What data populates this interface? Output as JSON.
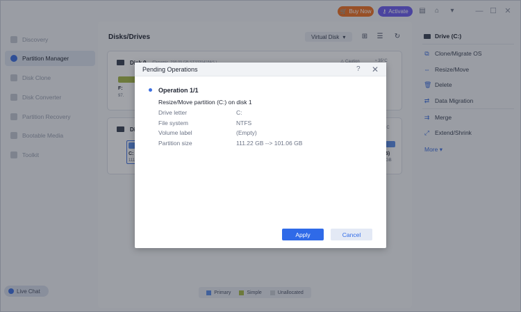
{
  "titlebar": {
    "buy_now": "Buy Now",
    "activate": "Activate",
    "buy_color": "#f07022",
    "activate_color": "#6b5cf0"
  },
  "sidebar": {
    "items": [
      {
        "label": "Discovery",
        "icon": "compass-icon",
        "active": false
      },
      {
        "label": "Partition Manager",
        "icon": "pie-chart-icon",
        "active": true
      },
      {
        "label": "Disk Clone",
        "icon": "clone-icon",
        "active": false
      },
      {
        "label": "Disk Converter",
        "icon": "convert-icon",
        "active": false
      },
      {
        "label": "Partition Recovery",
        "icon": "recovery-icon",
        "active": false
      },
      {
        "label": "Bootable Media",
        "icon": "media-icon",
        "active": false
      },
      {
        "label": "Toolkit",
        "icon": "toolkit-icon",
        "active": false
      }
    ],
    "live_chat": "Live Chat"
  },
  "main": {
    "title": "Disks/Drives",
    "view_select": "Virtual Disk",
    "disk0": {
      "name": "Disk 0",
      "sub": "(Dynamic, 298.09 GB,ST3320418AS )",
      "caution": "Caution",
      "temp": "35°C",
      "part_label": "F:",
      "part_size": "97."
    },
    "disk1": {
      "name": "Di",
      "temp": "°C",
      "part_label": "C:",
      "part_size": "111",
      "right_label": "5)",
      "right_size": "GB"
    },
    "legend": {
      "primary": "Primary",
      "simple": "Simple",
      "unallocated": "Unallocated",
      "primary_color": "#5b8de8",
      "simple_color": "#a5b846",
      "unallocated_color": "#c9cdd5"
    }
  },
  "rpanel": {
    "drive": "Drive (C:)",
    "items": [
      {
        "label": "Clone/Migrate OS",
        "icon": "clone-os-icon"
      },
      {
        "label": "Resize/Move",
        "icon": "resize-icon"
      },
      {
        "label": "Delete",
        "icon": "trash-icon"
      },
      {
        "label": "Data Migration",
        "icon": "migration-icon"
      },
      {
        "label": "Merge",
        "icon": "merge-icon"
      },
      {
        "label": "Extend/Shrink",
        "icon": "extend-icon"
      }
    ],
    "more": "More"
  },
  "dialog": {
    "title": "Pending Operations",
    "op_title": "Operation 1/1",
    "op_desc": "Resize/Move partition (C:) on disk 1",
    "rows": [
      {
        "label": "Drive letter",
        "value": "C:"
      },
      {
        "label": "File system",
        "value": "NTFS"
      },
      {
        "label": "Volume label",
        "value": "(Empty)"
      },
      {
        "label": "Partition size",
        "value": "111.22 GB --> 101.06 GB"
      }
    ],
    "apply": "Apply",
    "cancel": "Cancel"
  }
}
